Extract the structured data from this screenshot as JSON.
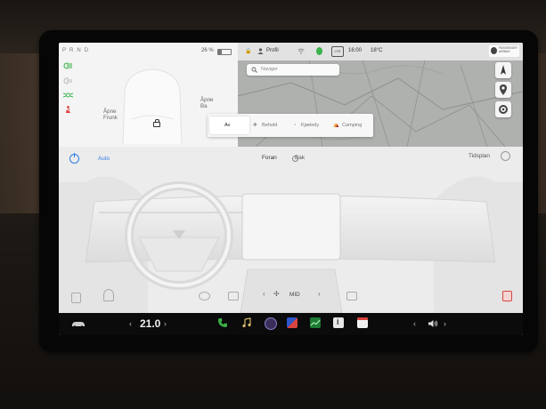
{
  "gear": "P R N D",
  "battery": "26 %",
  "status": {
    "profile": "Profil",
    "time": "16:00",
    "temp": "18°C",
    "airbag": "PASSENGER AIRBAG"
  },
  "doors": {
    "front_left_1": "Åpne",
    "front_left_2": "Frunk",
    "trunk_1": "Åpne",
    "trunk_2": "Ba"
  },
  "map": {
    "search_placeholder": "Naviger"
  },
  "climate_modes": [
    "Av",
    "Behold",
    "Kjæledy",
    "Camping"
  ],
  "climate": {
    "auto": "Auto",
    "front": "Foran",
    "rear": "Bak",
    "schedule": "Tidsplan",
    "fan_level": "MID",
    "fan_left": "‹",
    "fan_right": "›"
  },
  "bottom": {
    "temperature": "21.0",
    "temp_left": "‹",
    "temp_right": "›",
    "vol_left": "‹",
    "vol_right": "›"
  },
  "colors": {
    "accent_blue": "#2f7de1",
    "green_indicator": "#3ab34a",
    "red_indicator": "#d9433d"
  },
  "icons": [
    "car-icon",
    "phone-icon",
    "music-icon",
    "camera-icon",
    "apps-icon",
    "stock-icon",
    "info-icon",
    "calendar-icon",
    "volume-icon"
  ]
}
